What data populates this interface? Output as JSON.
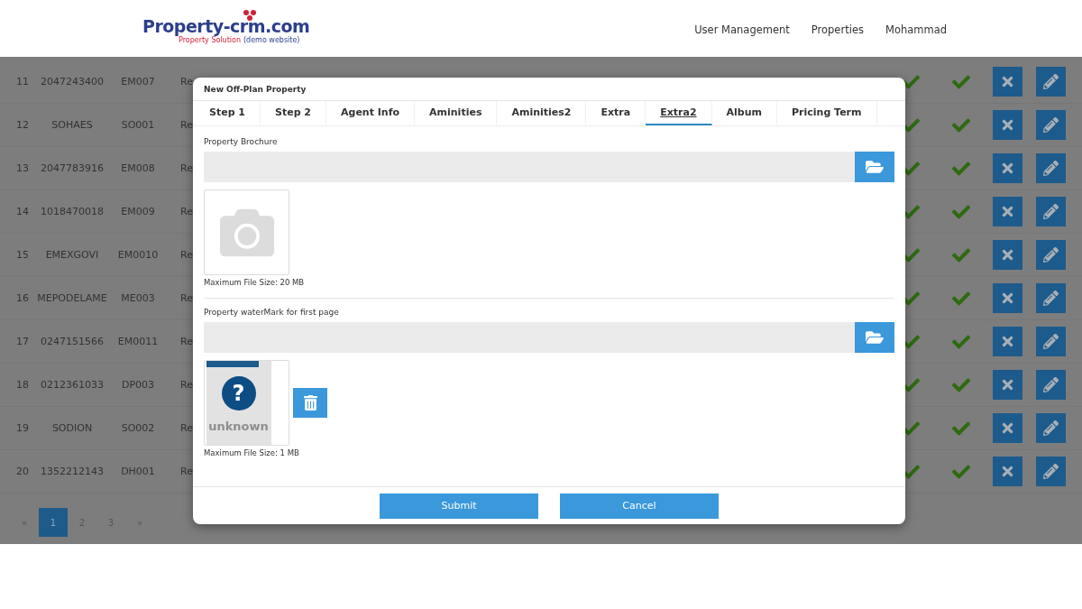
{
  "header": {
    "logo": {
      "name": "Property-crm.com",
      "tagline": "Property Solution",
      "tagline_note": "(demo website)"
    },
    "nav": [
      "User Management",
      "Properties",
      "Mohammad"
    ]
  },
  "table": {
    "rows": [
      {
        "cells": [
          "11",
          "2047243400",
          "EM007",
          "Re"
        ]
      },
      {
        "cells": [
          "12",
          "SOHAES",
          "SO001",
          "Re"
        ]
      },
      {
        "cells": [
          "13",
          "2047783916",
          "EM008",
          "Re"
        ]
      },
      {
        "cells": [
          "14",
          "1018470018",
          "EM009",
          "Re"
        ]
      },
      {
        "cells": [
          "15",
          "EMEXGOVI",
          "EM0010",
          "Re"
        ]
      },
      {
        "cells": [
          "16",
          "MEPODELAME",
          "ME003",
          "Re"
        ]
      },
      {
        "cells": [
          "17",
          "0247151566",
          "EM0011",
          "Re"
        ]
      },
      {
        "cells": [
          "18",
          "0212361033",
          "DP003",
          "Re"
        ]
      },
      {
        "cells": [
          "19",
          "SODION",
          "SO002",
          "Re"
        ]
      },
      {
        "cells": [
          "20",
          "1352212143",
          "DH001",
          "Re"
        ]
      }
    ]
  },
  "pagination": {
    "prev": "«",
    "next": "»",
    "pages": [
      {
        "label": "1",
        "selected": true
      },
      {
        "label": "2",
        "selected": false
      },
      {
        "label": "3",
        "selected": false
      }
    ]
  },
  "modal": {
    "title": "New Off-Plan Property",
    "tabs": [
      {
        "label": "Step 1",
        "selected": false
      },
      {
        "label": "Step 2",
        "selected": false
      },
      {
        "label": "Agent Info",
        "selected": false
      },
      {
        "label": "Aminities",
        "selected": false
      },
      {
        "label": "Aminities2",
        "selected": false
      },
      {
        "label": "Extra",
        "selected": false
      },
      {
        "label": "Extra2",
        "selected": true
      },
      {
        "label": "Album",
        "selected": false
      },
      {
        "label": "Pricing Term",
        "selected": false
      }
    ],
    "sections": [
      {
        "label": "Property Brochure",
        "preview": {
          "kind": "camera"
        },
        "deletable": false,
        "note": "Maximum File Size: 20 MB"
      },
      {
        "label": "Property waterMark for first page",
        "preview": {
          "kind": "unknown",
          "glyph": "?",
          "caption": "unknown"
        },
        "deletable": true,
        "note": "Maximum File Size: 1 MB"
      }
    ],
    "buttons": [
      "Submit",
      "Cancel"
    ]
  }
}
